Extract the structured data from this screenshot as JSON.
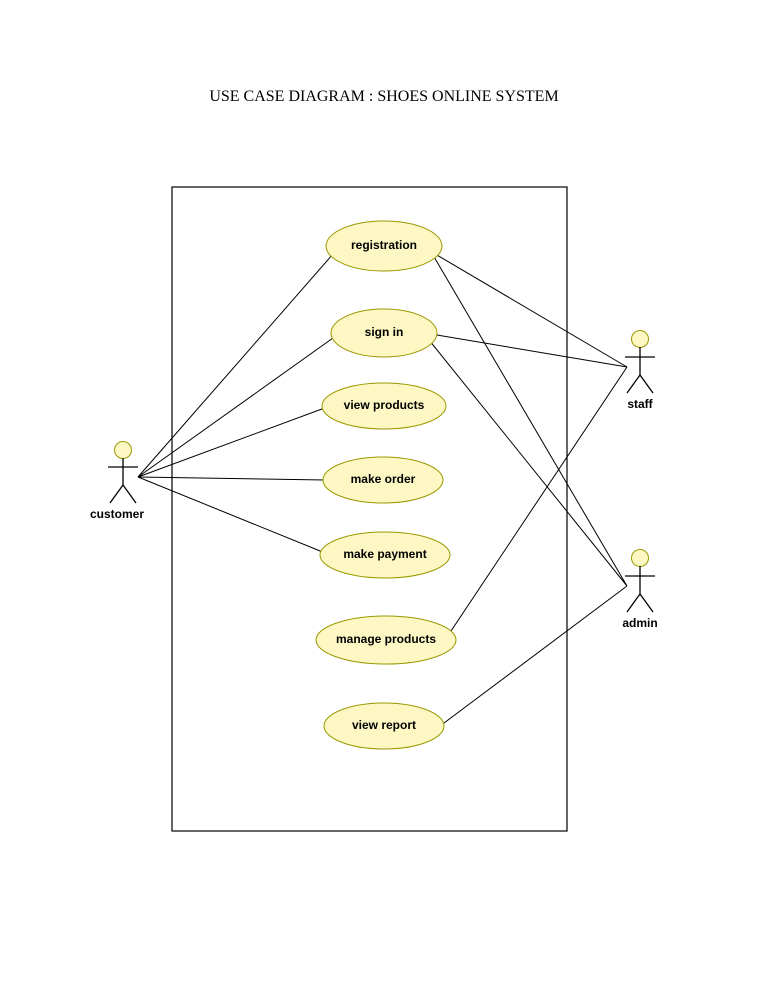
{
  "title": "USE CASE DIAGRAM : SHOES ONLINE SYSTEM",
  "actors": {
    "customer": "customer",
    "staff": "staff",
    "admin": "admin"
  },
  "usecases": {
    "registration": "registration",
    "signin": "sign in",
    "viewproducts": "view products",
    "makeorder": "make order",
    "makepayment": "make payment",
    "manageproducts": "manage products",
    "viewreport": "view report"
  }
}
